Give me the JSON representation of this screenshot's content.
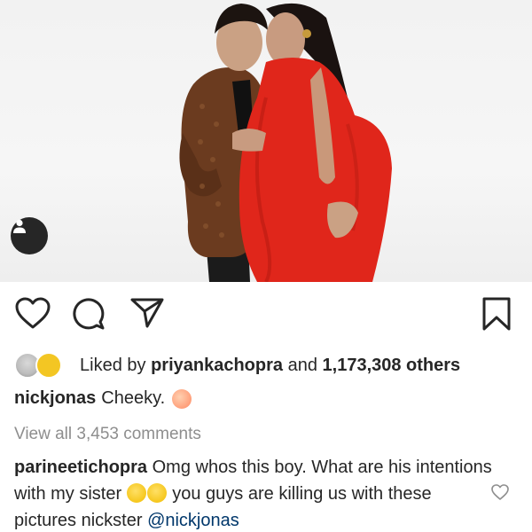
{
  "post": {
    "liked_by_prefix": "Liked by",
    "liked_by_user": "priyankachopra",
    "liked_by_and": "and",
    "liked_by_count": "1,173,308 others",
    "caption_user": "nickjonas",
    "caption_text": "Cheeky.",
    "view_all_comments": "View all 3,453 comments"
  },
  "comment": {
    "user": "parineetichopra",
    "text_1": "Omg whos this boy. What are his intentions with my sister",
    "text_2": "you guys are killing us with these pictures nickster",
    "mention": "@nickjonas"
  },
  "icons": {
    "like": "heart-outline-icon",
    "comment": "comment-bubble-icon",
    "share": "paper-plane-icon",
    "save": "bookmark-icon",
    "tagged": "user-tag-icon",
    "comment_like": "small-heart-icon"
  },
  "colors": {
    "text": "#262626",
    "muted": "#8e8e8e",
    "mention": "#00376b",
    "dress_red": "#e0261b"
  }
}
